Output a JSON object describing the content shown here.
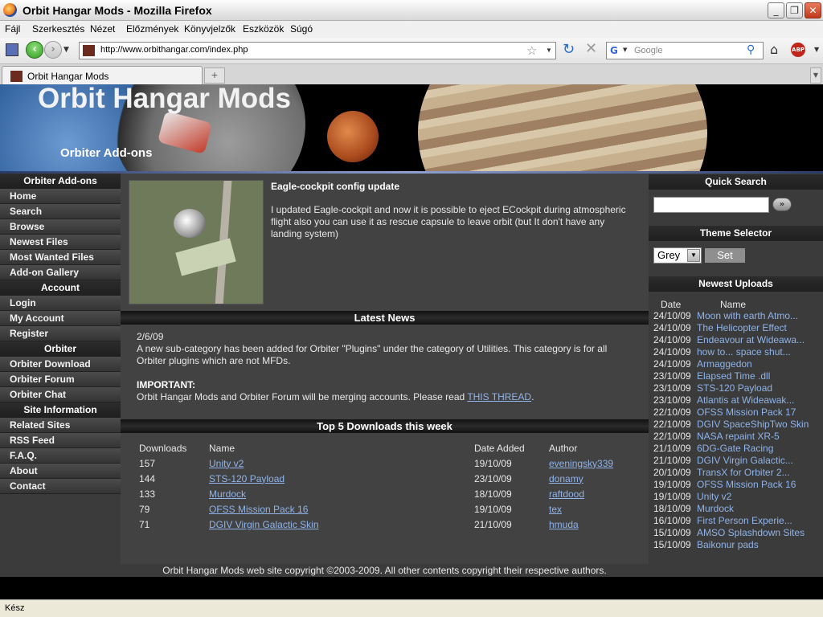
{
  "window": {
    "title": "Orbit Hangar Mods - Mozilla Firefox"
  },
  "menu": [
    "Fájl",
    "Szerkesztés",
    "Nézet",
    "Előzmények",
    "Könyvjelzők",
    "Eszközök",
    "Súgó"
  ],
  "address": {
    "url": "http://www.orbithangar.com/index.php"
  },
  "search": {
    "placeholder": "Google"
  },
  "tab": {
    "label": "Orbit Hangar Mods"
  },
  "banner": {
    "title": "Orbit Hangar Mods",
    "subtitle": "Orbiter Add-ons"
  },
  "sidebar": {
    "sections": [
      {
        "header": "Orbiter Add-ons",
        "items": [
          "Home",
          "Search",
          "Browse",
          "Newest Files",
          "Most Wanted Files",
          "Add-on Gallery"
        ]
      },
      {
        "header": "Account",
        "items": [
          "Login",
          "My Account",
          "Register"
        ]
      },
      {
        "header": "Orbiter",
        "items": [
          "Orbiter Download",
          "Orbiter Forum",
          "Orbiter Chat"
        ]
      },
      {
        "header": "Site Information",
        "items": [
          "Related Sites",
          "RSS Feed",
          "F.A.Q.",
          "About",
          "Contact"
        ]
      }
    ]
  },
  "feature": {
    "title": "Eagle-cockpit config update",
    "text": "I updated Eagle-cockpit and now it is possible to eject ECockpit during atmospheric flight also you can use it as rescue capsule to leave orbit (but It don't have any landing system)"
  },
  "news": {
    "header": "Latest News",
    "date": "2/6/09",
    "body": "A new sub-category has been added for Orbiter \"Plugins\" under the category of Utilities. This category is for all Orbiter plugins which are not MFDs.",
    "important_label": "IMPORTANT:",
    "important_text": "Orbit Hangar Mods and Orbiter Forum will be merging accounts. Please read ",
    "important_link": "THIS THREAD",
    "important_end": "."
  },
  "top": {
    "header": "Top 5 Downloads this week",
    "columns": [
      "Downloads",
      "Name",
      "Date Added",
      "Author"
    ],
    "rows": [
      {
        "downloads": "157",
        "name": "Unity v2",
        "date": "19/10/09",
        "author": "eveningsky339"
      },
      {
        "downloads": "144",
        "name": "STS-120 Payload",
        "date": "23/10/09",
        "author": "donamy"
      },
      {
        "downloads": "133",
        "name": "Murdock",
        "date": "18/10/09",
        "author": "raftdood"
      },
      {
        "downloads": "79",
        "name": "OFSS Mission Pack 16",
        "date": "19/10/09",
        "author": "tex"
      },
      {
        "downloads": "71",
        "name": "DGIV Virgin Galactic Skin",
        "date": "21/10/09",
        "author": "hmuda"
      }
    ]
  },
  "right": {
    "quick_search": "Quick Search",
    "go": "»",
    "theme_header": "Theme Selector",
    "theme_value": "Grey",
    "set": "Set",
    "uploads_header": "Newest Uploads",
    "uploads_cols": [
      "Date",
      "Name"
    ],
    "uploads": [
      {
        "date": "24/10/09",
        "name": "Moon with earth Atmo..."
      },
      {
        "date": "24/10/09",
        "name": "The Helicopter Effect"
      },
      {
        "date": "24/10/09",
        "name": "Endeavour at Wideawa..."
      },
      {
        "date": "24/10/09",
        "name": "how to... space shut..."
      },
      {
        "date": "24/10/09",
        "name": "Armaggedon"
      },
      {
        "date": "23/10/09",
        "name": "Elapsed Time .dll"
      },
      {
        "date": "23/10/09",
        "name": "STS-120 Payload"
      },
      {
        "date": "23/10/09",
        "name": "Atlantis at Wideawak..."
      },
      {
        "date": "22/10/09",
        "name": "OFSS Mission Pack 17"
      },
      {
        "date": "22/10/09",
        "name": "DGIV SpaceShipTwo Skin"
      },
      {
        "date": "22/10/09",
        "name": "NASA repaint XR-5"
      },
      {
        "date": "21/10/09",
        "name": "6DG-Gate Racing"
      },
      {
        "date": "21/10/09",
        "name": "DGIV Virgin Galactic..."
      },
      {
        "date": "20/10/09",
        "name": "TransX for Orbiter 2..."
      },
      {
        "date": "19/10/09",
        "name": "OFSS Mission Pack 16"
      },
      {
        "date": "19/10/09",
        "name": "Unity v2"
      },
      {
        "date": "18/10/09",
        "name": "Murdock"
      },
      {
        "date": "16/10/09",
        "name": "First Person Experie..."
      },
      {
        "date": "15/10/09",
        "name": "AMSO Splashdown Sites"
      },
      {
        "date": "15/10/09",
        "name": "Baikonur pads"
      }
    ]
  },
  "footer": {
    "text": "Orbit Hangar Mods web site copyright ©2003-2009. All other contents copyright their respective authors."
  },
  "status": {
    "text": "Kész"
  }
}
